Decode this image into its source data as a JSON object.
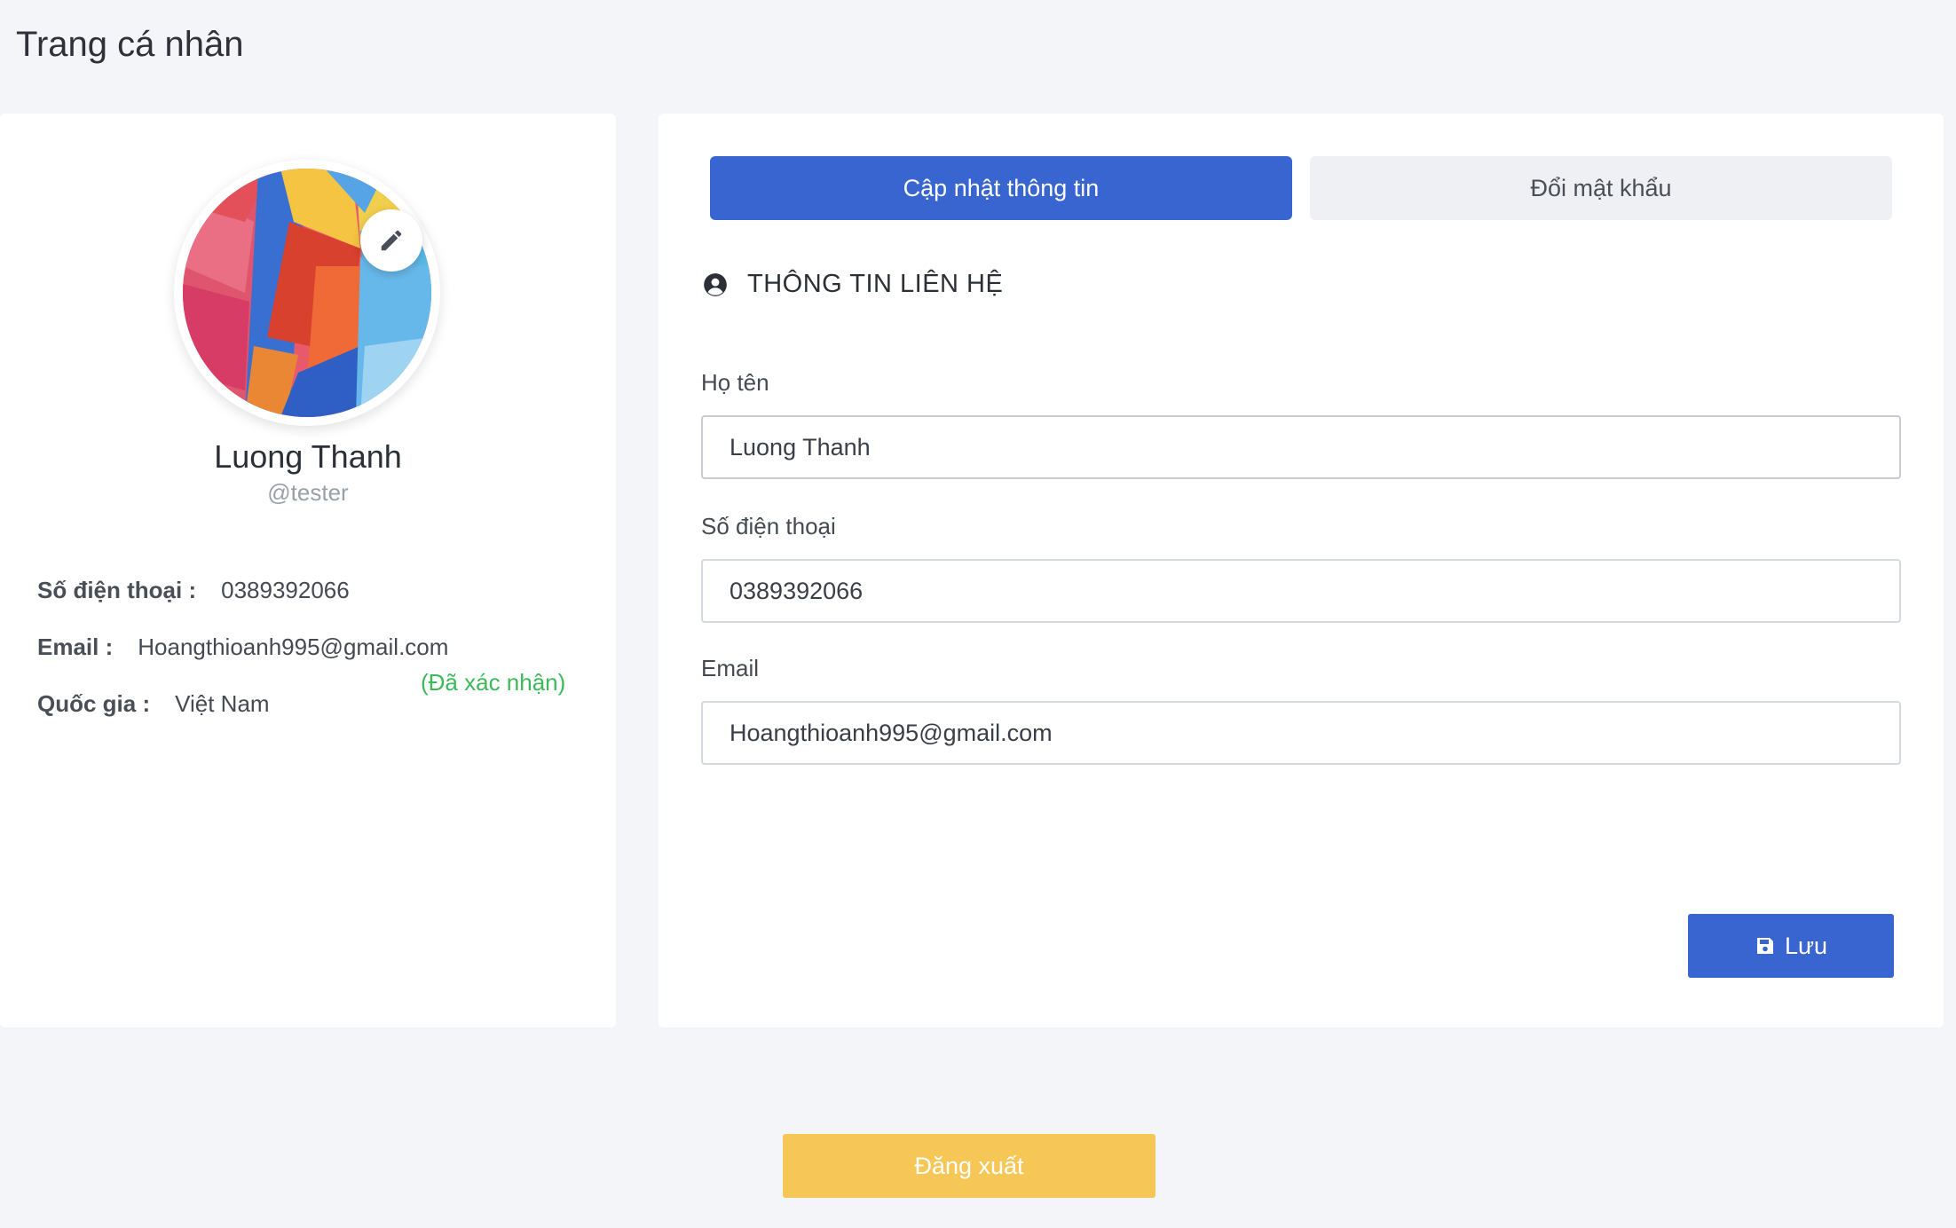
{
  "page": {
    "title": "Trang cá nhân"
  },
  "profile": {
    "name": "Luong Thanh",
    "username": "@tester",
    "avatar_icon": "abstract-avatar-image",
    "edit_icon": "pencil-icon",
    "phone_label": "Số điện thoại :",
    "phone_value": "0389392066",
    "email_label": "Email :",
    "email_value": "Hoangthioanh995@gmail.com",
    "verified_text": "(Đã xác nhận)",
    "country_label": "Quốc gia :",
    "country_value": "Việt Nam"
  },
  "tabs": [
    {
      "label": "Cập nhật thông tin",
      "active": true
    },
    {
      "label": "Đổi mật khẩu",
      "active": false
    }
  ],
  "form": {
    "section_title": "THÔNG TIN LIÊN HỆ",
    "section_icon": "user-circle-icon",
    "fields": {
      "name": {
        "label": "Họ tên",
        "value": "Luong Thanh"
      },
      "phone": {
        "label": "Số điện thoại",
        "value": "0389392066"
      },
      "email": {
        "label": "Email",
        "value": "Hoangthioanh995@gmail.com"
      }
    },
    "save_label": "Lưu",
    "save_icon": "floppy-disk-icon"
  },
  "logout_label": "Đăng xuất",
  "colors": {
    "primary": "#3965d1",
    "warning": "#f6c757",
    "success": "#3cb95a",
    "background": "#f4f5f8"
  }
}
